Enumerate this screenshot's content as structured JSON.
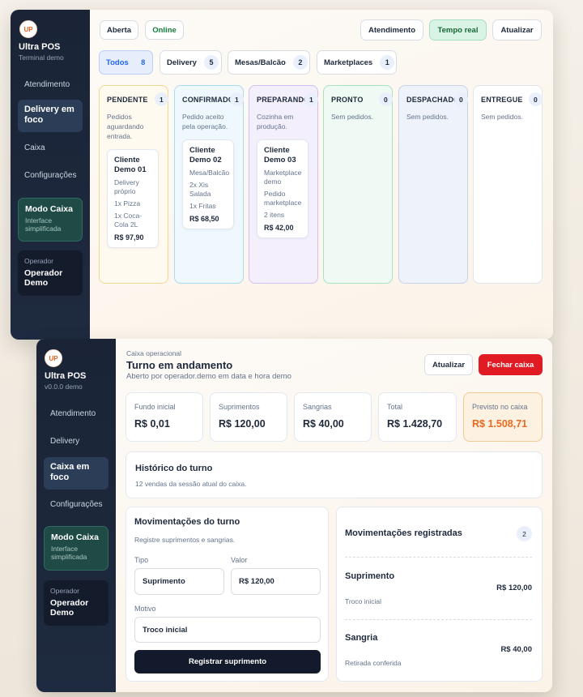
{
  "window1": {
    "app_name": "Ultra POS",
    "app_sub": "Terminal demo",
    "logo": "UP",
    "nav": [
      "Atendimento",
      "Delivery em foco",
      "Caixa",
      "Configurações"
    ],
    "mode": {
      "title": "Modo Caixa",
      "sub": "Interface simplificada"
    },
    "operator": {
      "label": "Operador",
      "name": "Operador Demo"
    },
    "status": [
      "Aberta",
      "Online"
    ],
    "actions": [
      "Atendimento",
      "Tempo real",
      "Atualizar"
    ],
    "filters": [
      {
        "label": "Todos",
        "count": "8"
      },
      {
        "label": "Delivery",
        "count": "5"
      },
      {
        "label": "Mesas/Balcão",
        "count": "2"
      },
      {
        "label": "Marketplaces",
        "count": "1"
      }
    ],
    "columns": [
      {
        "title": "PENDENTE",
        "count": "1",
        "desc": "Pedidos aguardando entrada.",
        "bg": "#fffaf0",
        "border": "#f3d98f",
        "order": {
          "name": "Cliente Demo 01",
          "lines": [
            "Delivery próprio",
            "1x Pizza",
            "1x Coca-Cola 2L"
          ],
          "price": "R$ 97,90"
        }
      },
      {
        "title": "CONFIRMADO",
        "count": "1",
        "desc": "Pedido aceito pela operação.",
        "bg": "#eef8fd",
        "border": "#a9dbee",
        "order": {
          "name": "Cliente Demo 02",
          "lines": [
            "Mesa/Balcão",
            "2x Xis Salada",
            "1x Fritas"
          ],
          "price": "R$ 68,50"
        }
      },
      {
        "title": "PREPARANDO",
        "count": "1",
        "desc": "Cozinha em produção.",
        "bg": "#f3effc",
        "border": "#cfc0f0",
        "order": {
          "name": "Cliente Demo 03",
          "lines": [
            "Marketplace demo",
            "Pedido marketplace",
            "2 itens"
          ],
          "price": "R$ 42,00"
        }
      },
      {
        "title": "PRONTO",
        "count": "0",
        "desc": "Sem pedidos.",
        "bg": "#eefaf3",
        "border": "#a8e2c3"
      },
      {
        "title": "DESPACHADO",
        "count": "0",
        "desc": "Sem pedidos.",
        "bg": "#eef2fb",
        "border": "#c6d1ea"
      },
      {
        "title": "ENTREGUE",
        "count": "0",
        "desc": "Sem pedidos.",
        "bg": "#ffffff",
        "border": "#dfe4ea"
      }
    ]
  },
  "window2": {
    "app_name": "Ultra POS",
    "app_sub": "v0.0.0 demo",
    "logo": "UP",
    "nav": [
      "Atendimento",
      "Delivery",
      "Caixa em foco",
      "Configurações"
    ],
    "mode": {
      "title": "Modo Caixa",
      "sub": "Interface simplificada"
    },
    "operator": {
      "label": "Operador",
      "name": "Operador Demo"
    },
    "header": {
      "eyebrow": "Caixa operacional",
      "title": "Turno em andamento",
      "sub": "Aberto por operador.demo em data e hora demo"
    },
    "buttons": {
      "refresh": "Atualizar",
      "close": "Fechar caixa"
    },
    "stats": [
      {
        "label": "Fundo inicial",
        "value": "R$ 0,01"
      },
      {
        "label": "Suprimentos",
        "value": "R$ 120,00"
      },
      {
        "label": "Sangrias",
        "value": "R$ 40,00"
      },
      {
        "label": "Total",
        "value": "R$ 1.428,70"
      },
      {
        "label": "Previsto no caixa",
        "value": "R$ 1.508,71"
      }
    ],
    "history": {
      "title": "Histórico do turno",
      "sub": "12 vendas da sessão atual do caixa."
    },
    "form": {
      "title": "Movimentações do turno",
      "sub": "Registre suprimentos e sangrias.",
      "type_label": "Tipo",
      "type_value": "Suprimento",
      "value_label": "Valor",
      "value_value": "R$ 120,00",
      "reason_label": "Motivo",
      "reason_value": "Troco inicial",
      "submit": "Registrar suprimento"
    },
    "registered": {
      "title": "Movimentações registradas",
      "count": "2",
      "items": [
        {
          "type": "Suprimento",
          "amount": "R$ 120,00",
          "note": "Troco inicial"
        },
        {
          "type": "Sangria",
          "amount": "R$ 40,00",
          "note": "Retirada conferida"
        }
      ]
    }
  }
}
